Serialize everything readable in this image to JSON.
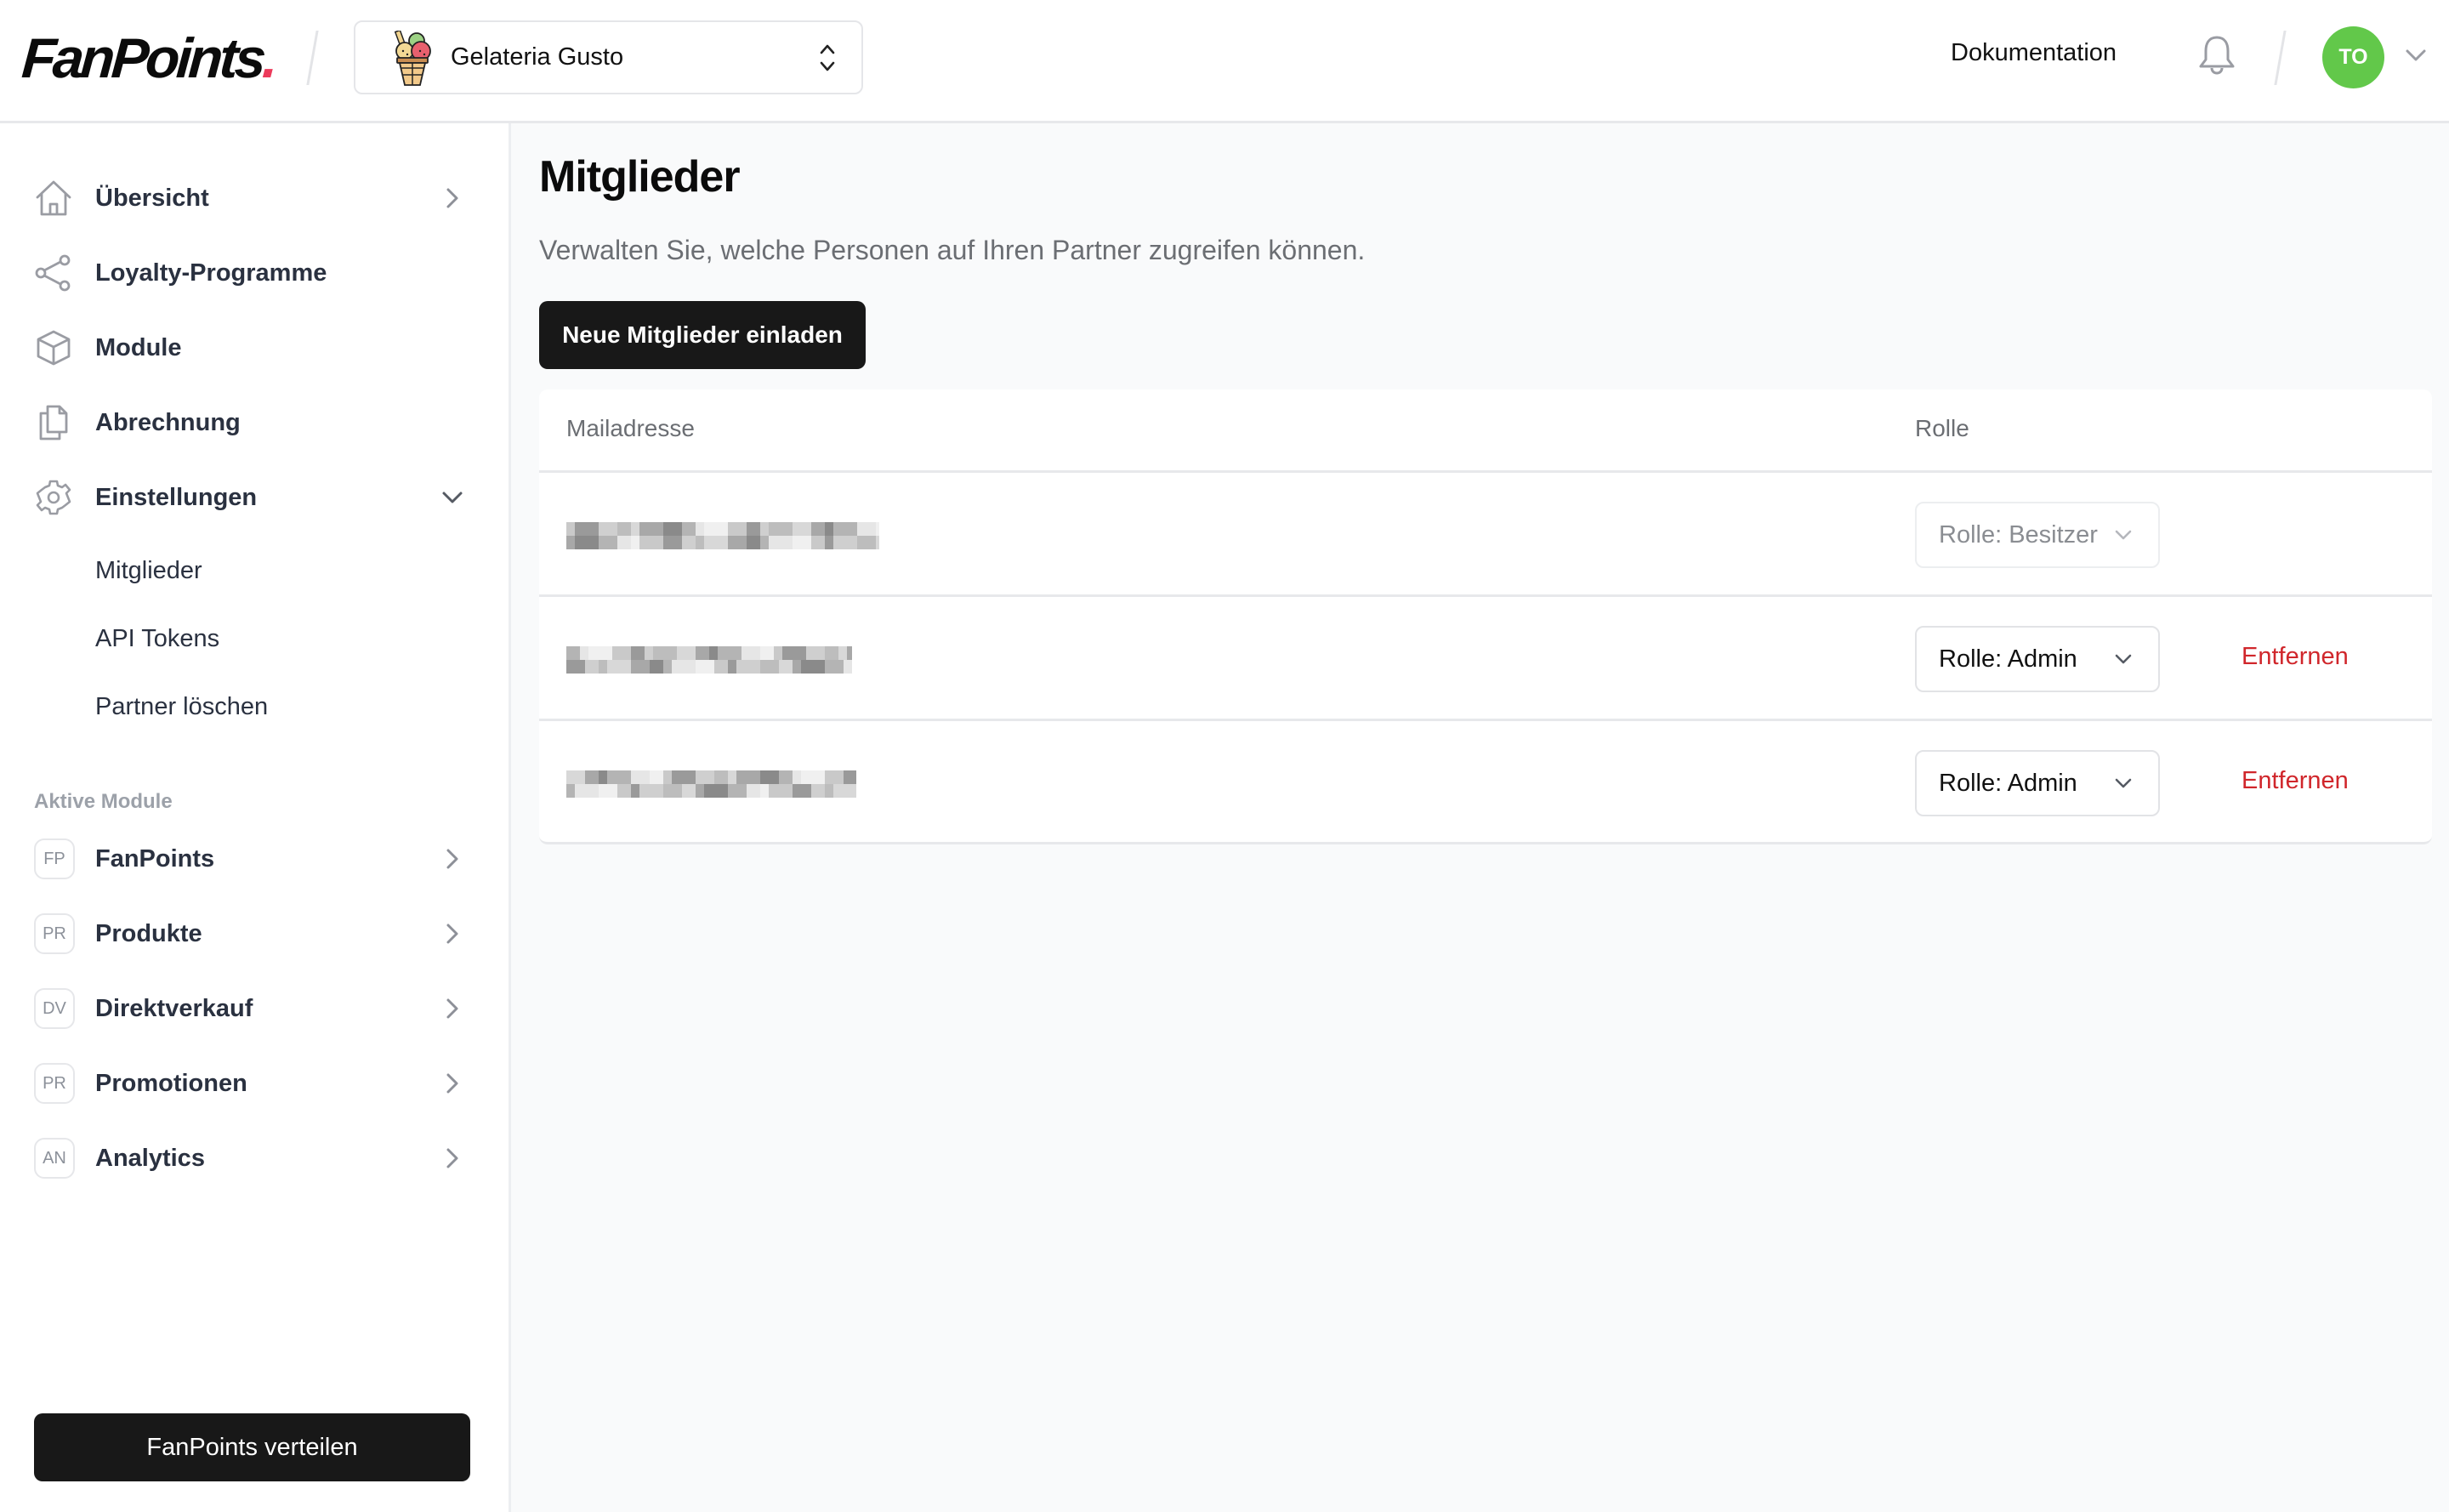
{
  "header": {
    "logo_text": "FanPoints",
    "logo_dot": ".",
    "partner": {
      "name": "Gelateria Gusto",
      "icon": "ice-cream-icon"
    },
    "documentation_link": "Dokumentation",
    "notifications_icon": "bell-icon",
    "user": {
      "initials": "TO",
      "avatar_color": "#62c84a"
    }
  },
  "sidebar": {
    "items": [
      {
        "label": "Übersicht",
        "icon": "home-icon",
        "chevron": "right"
      },
      {
        "label": "Loyalty-Programme",
        "icon": "share-icon",
        "chevron": ""
      },
      {
        "label": "Module",
        "icon": "cube-icon",
        "chevron": ""
      },
      {
        "label": "Abrechnung",
        "icon": "documents-icon",
        "chevron": ""
      },
      {
        "label": "Einstellungen",
        "icon": "gear-icon",
        "chevron": "down"
      }
    ],
    "settings_subitems": [
      {
        "label": "Mitglieder",
        "active": true
      },
      {
        "label": "API Tokens"
      },
      {
        "label": "Partner löschen"
      }
    ],
    "active_modules_label": "Aktive Module",
    "modules": [
      {
        "badge": "FP",
        "label": "FanPoints"
      },
      {
        "badge": "PR",
        "label": "Produkte"
      },
      {
        "badge": "DV",
        "label": "Direktverkauf"
      },
      {
        "badge": "PR",
        "label": "Promotionen"
      },
      {
        "badge": "AN",
        "label": "Analytics"
      }
    ],
    "cta_label": "FanPoints verteilen"
  },
  "main": {
    "title": "Mitglieder",
    "subtitle": "Verwalten Sie, welche Personen auf Ihren Partner zugreifen können.",
    "invite_button": "Neue Mitglieder einladen",
    "table": {
      "columns": [
        "Mailadresse",
        "Rolle"
      ],
      "rows": [
        {
          "email": "[redacted]",
          "role": "Rolle: Besitzer",
          "role_editable": false,
          "action": ""
        },
        {
          "email": "[redacted]",
          "role": "Rolle: Admin",
          "role_editable": true,
          "action": "Entfernen"
        },
        {
          "email": "[redacted]",
          "role": "Rolle: Admin",
          "role_editable": true,
          "action": "Entfernen"
        }
      ]
    },
    "colors": {
      "danger": "#d0262b",
      "primary_button": "#181818",
      "logo_dot": "#ec3b5b"
    }
  }
}
